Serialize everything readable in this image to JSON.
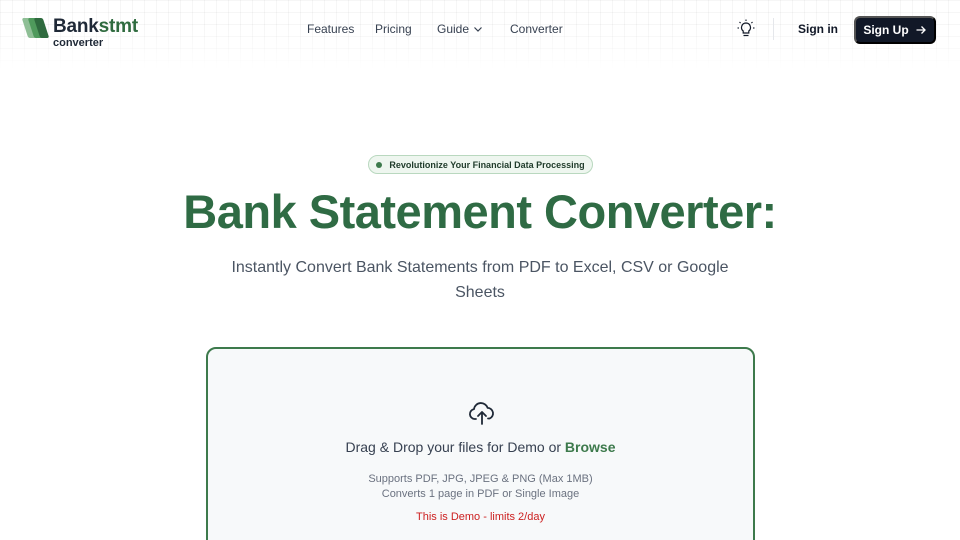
{
  "brand": {
    "name_part1": "Bank",
    "name_part2": "stmt",
    "subtitle": "converter",
    "colors": {
      "primary": "#2f6b44",
      "accent": "#3d7a4c",
      "dark": "#111827"
    }
  },
  "nav": {
    "links": [
      "Features",
      "Pricing",
      "Guide",
      "Converter"
    ],
    "guide_has_dropdown": true,
    "theme_icon": "lightbulb-icon",
    "signin_label": "Sign in",
    "signup_label": "Sign Up",
    "signup_icon": "arrow-right-icon"
  },
  "hero": {
    "badge": "Revolutionize Your Financial Data Processing",
    "title": "Bank Statement Converter:",
    "subtitle": "Instantly Convert Bank Statements from PDF to Excel, CSV or Google Sheets"
  },
  "upload": {
    "icon": "cloud-upload-icon",
    "drop_text": "Drag & Drop your files for Demo or ",
    "browse_label": "Browse",
    "support_line1": "Supports PDF, JPG, JPEG & PNG (Max 1MB)",
    "support_line2": "Converts 1 page in PDF or Single Image",
    "demo_notice": "This is Demo - limits 2/day",
    "demo_color": "#cc1f1f"
  }
}
